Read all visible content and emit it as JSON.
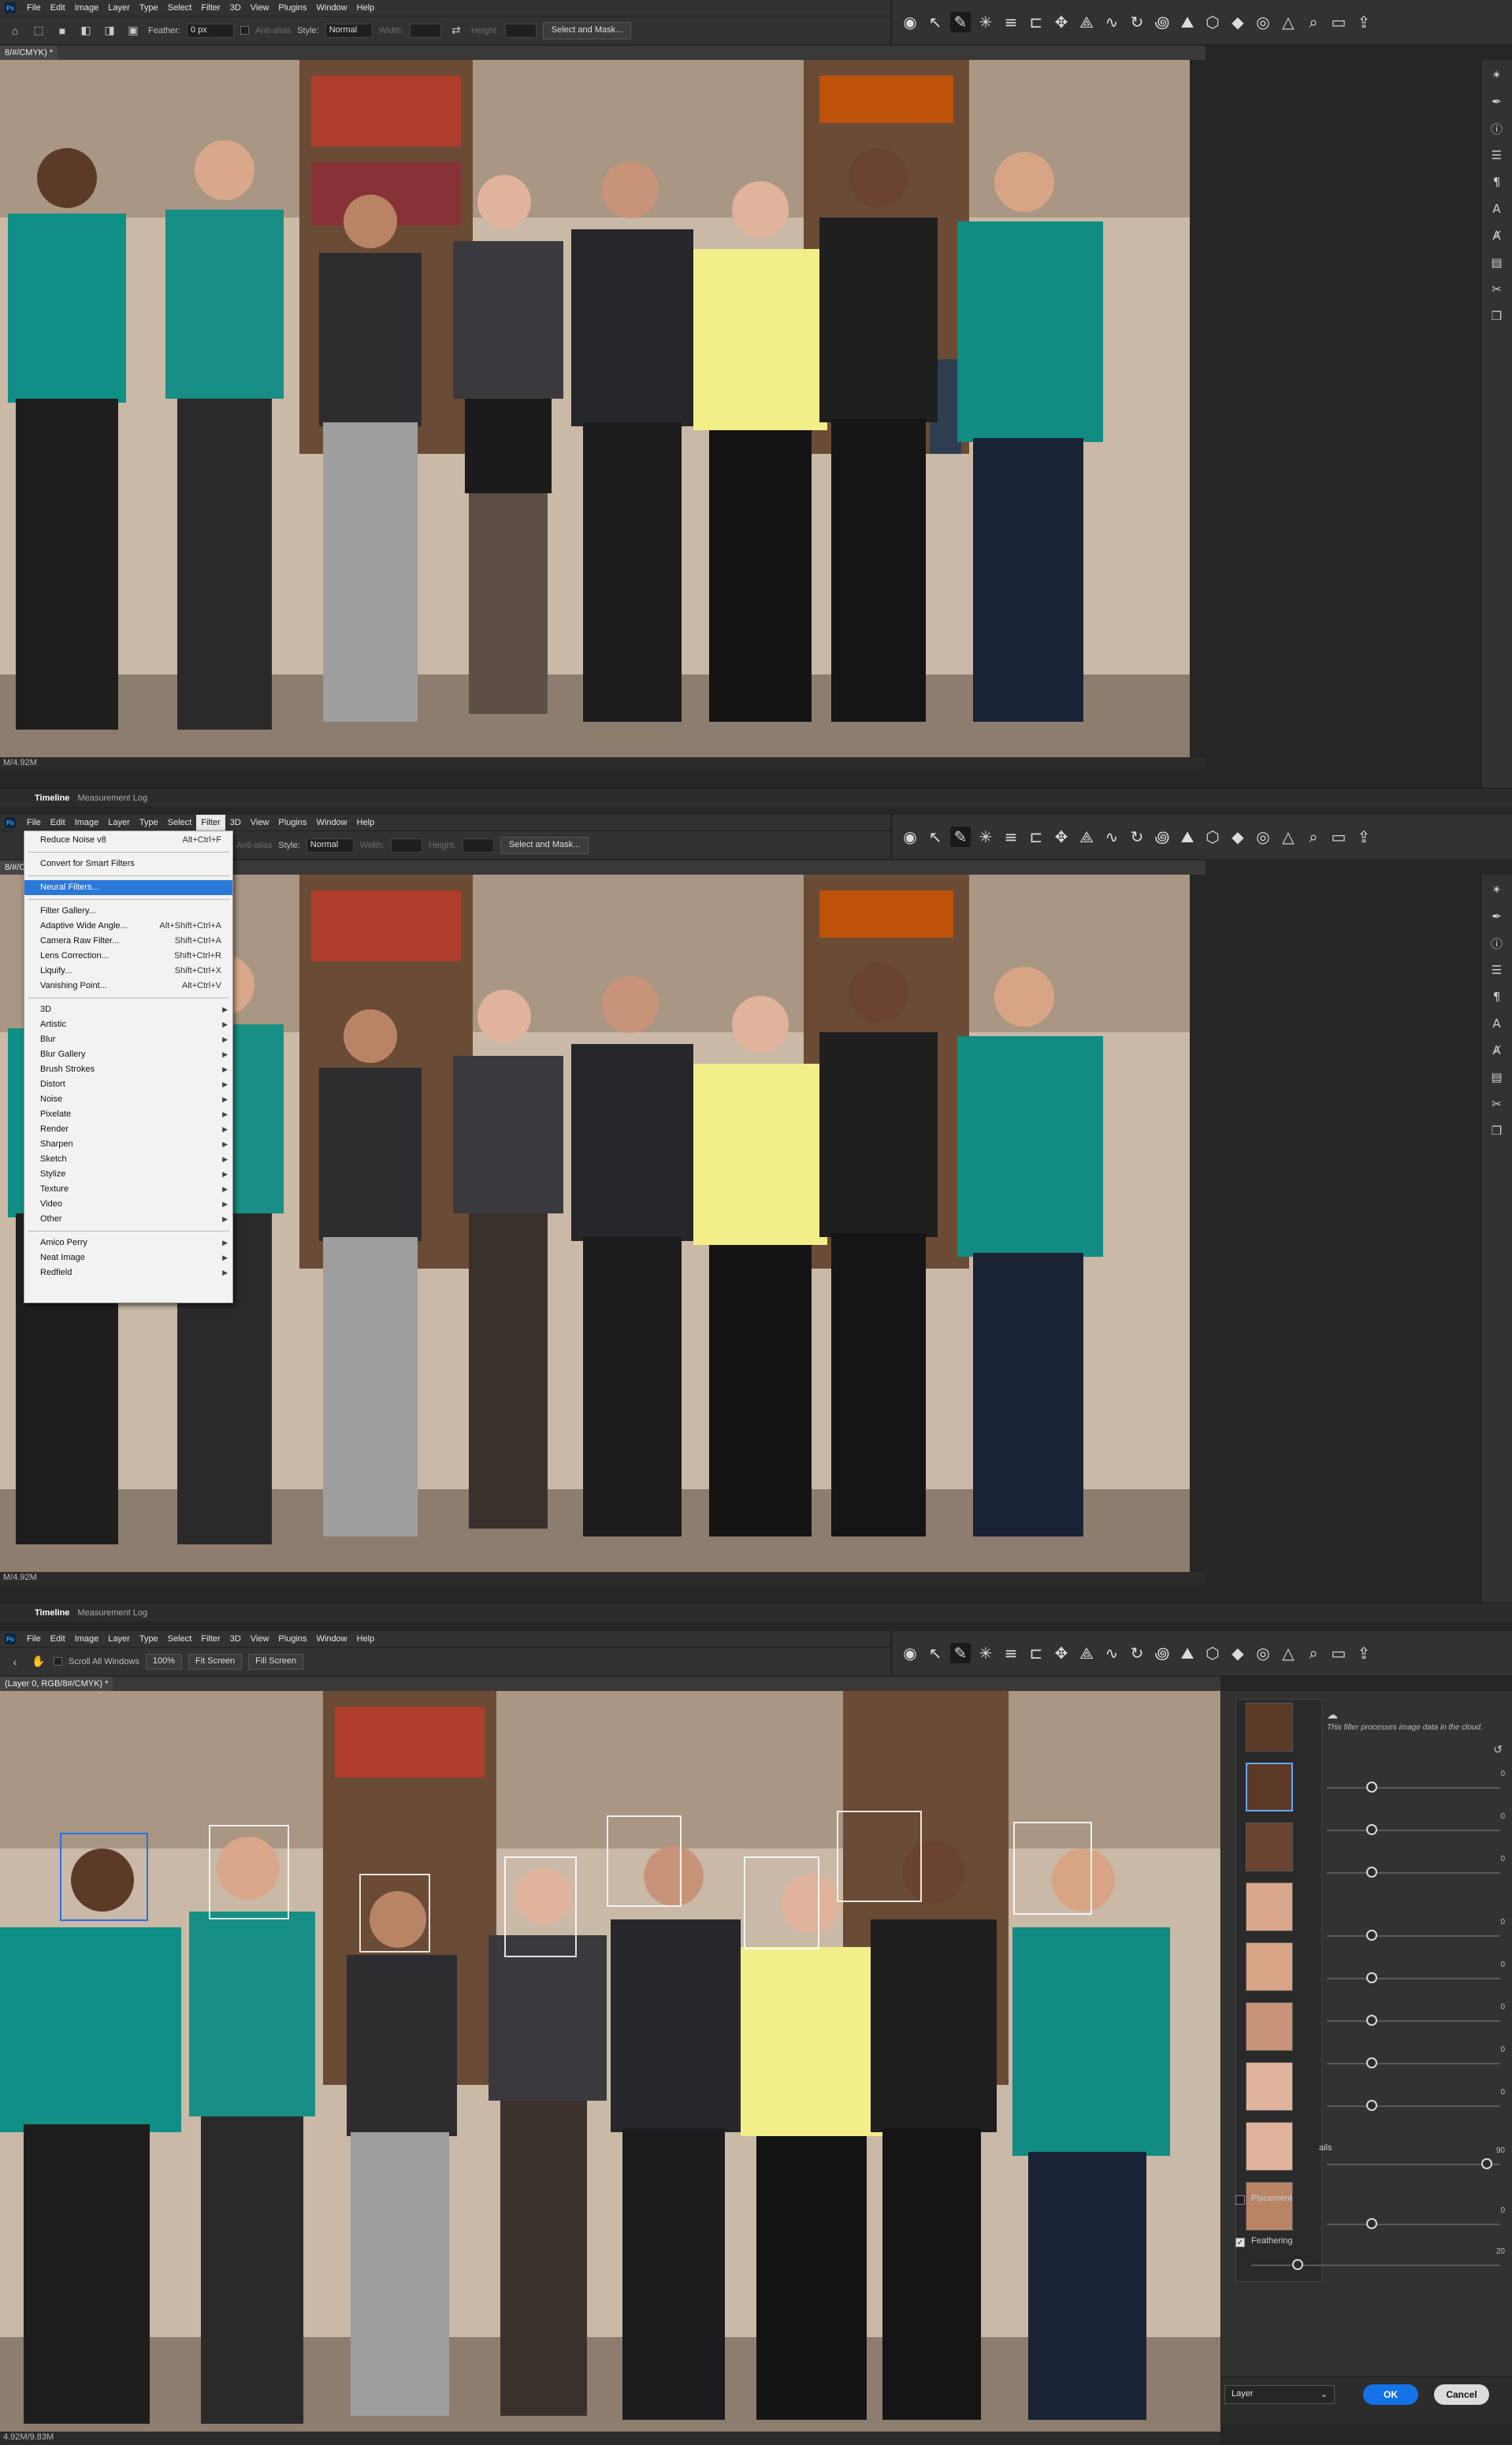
{
  "menu": {
    "ps_badge": "Ps",
    "items": [
      "File",
      "Edit",
      "Image",
      "Layer",
      "Type",
      "Select",
      "Filter",
      "3D",
      "View",
      "Plugins",
      "Window",
      "Help"
    ]
  },
  "panel1": {
    "options": {
      "feather_label": "Feather:",
      "feather_value": "0 px",
      "antialias_label": "Anti-alias",
      "style_label": "Style:",
      "style_value": "Normal",
      "width_label": "Width:",
      "height_label": "Height:",
      "select_mask": "Select and Mask..."
    },
    "tab_title": "8/#/CMYK) *",
    "status": "M/4.92M"
  },
  "panel2": {
    "tab_title": "8/#/CMYK) *",
    "status": "M/4.92M",
    "filter_menu": {
      "items": [
        {
          "label": "Reduce Noise v8",
          "shortcut": "Alt+Ctrl+F"
        },
        {
          "label": "Convert for Smart Filters",
          "shortcut": ""
        },
        {
          "label": "Neural Filters...",
          "shortcut": ""
        },
        {
          "label": "Filter Gallery...",
          "shortcut": ""
        },
        {
          "label": "Adaptive Wide Angle...",
          "shortcut": "Alt+Shift+Ctrl+A"
        },
        {
          "label": "Camera Raw Filter...",
          "shortcut": "Shift+Ctrl+A"
        },
        {
          "label": "Lens Correction...",
          "shortcut": "Shift+Ctrl+R"
        },
        {
          "label": "Liquify...",
          "shortcut": "Shift+Ctrl+X"
        },
        {
          "label": "Vanishing Point...",
          "shortcut": "Alt+Ctrl+V"
        }
      ],
      "submenus": [
        "3D",
        "Artistic",
        "Blur",
        "Blur Gallery",
        "Brush Strokes",
        "Distort",
        "Noise",
        "Pixelate",
        "Render",
        "Sharpen",
        "Sketch",
        "Stylize",
        "Texture",
        "Video",
        "Other"
      ],
      "plugins": [
        "Amico Perry",
        "Neat Image",
        "Redfield"
      ]
    }
  },
  "panel3": {
    "nav": {
      "scroll_all": "Scroll All Windows",
      "zoom": "100%",
      "fit_screen": "Fit Screen",
      "fill_screen": "Fill Screen"
    },
    "tab_title": "(Layer 0, RGB/8#/CMYK) *",
    "status": "4.92M/9.83M",
    "neural": {
      "cloud_note": "This filter processes image data in the cloud.",
      "slider_values": [
        "0",
        "0",
        "0",
        "0",
        "0",
        "0",
        "0",
        "0"
      ],
      "strength_label": "ails",
      "strength_value": "90",
      "placement_label": "Placement",
      "placement_value": "0",
      "feathering_label": "Feathering",
      "feathering_value": "20",
      "output_value": "Layer",
      "ok": "OK",
      "cancel": "Cancel"
    }
  },
  "bottom_tabs": {
    "timeline": "Timeline",
    "measurement": "Measurement Log"
  },
  "colors": {
    "accent": "#1473e6",
    "menu_highlight": "#2b78d8",
    "face_selected": "#2e6ee6"
  }
}
